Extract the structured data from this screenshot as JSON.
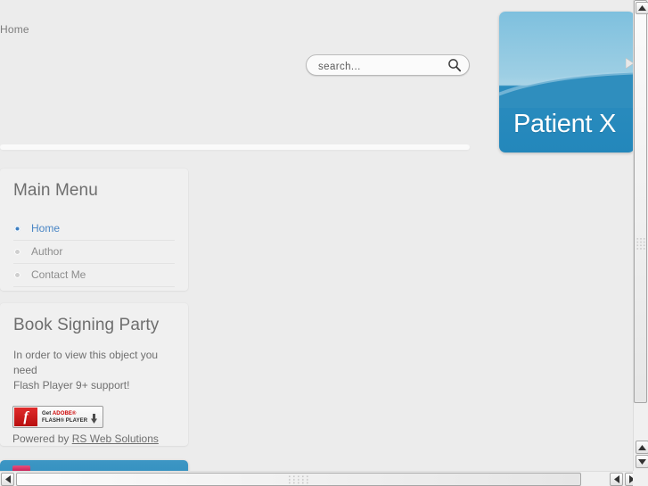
{
  "breadcrumb": {
    "text": "Home"
  },
  "search": {
    "placeholder": "search...",
    "value": "",
    "icon": "search-icon"
  },
  "banner": {
    "title": "Patient X",
    "next_icon": "chevron-right-icon",
    "color_top": "#7ec0de",
    "color_bottom": "#2387bb"
  },
  "sidebar": {
    "main_menu": {
      "title": "Main Menu",
      "items": [
        {
          "label": "Home",
          "active": true
        },
        {
          "label": "Author",
          "active": false
        },
        {
          "label": "Contact Me",
          "active": false
        }
      ]
    },
    "book_signing": {
      "title": "Book Signing Party",
      "flash_message_line1": "In order to view this object you need",
      "flash_message_line2": "Flash Player 9+ support!",
      "flash_badge": {
        "logo_glyph": "f",
        "line1_prefix": "Get ",
        "line1_brand": "ADOBE®",
        "line2": "FLASH® PLAYER",
        "download_icon": "download-arrow-icon"
      },
      "powered_by_prefix": "Powered by ",
      "powered_by_link": "RS Web Solutions"
    }
  },
  "scrollbars": {
    "vertical": {
      "up_icon": "triangle-up-icon",
      "up2_icon": "triangle-up-icon",
      "down_icon": "triangle-down-icon"
    },
    "horizontal": {
      "left_icon": "triangle-left-icon",
      "left2_icon": "triangle-left-icon",
      "right_icon": "triangle-right-icon"
    }
  }
}
